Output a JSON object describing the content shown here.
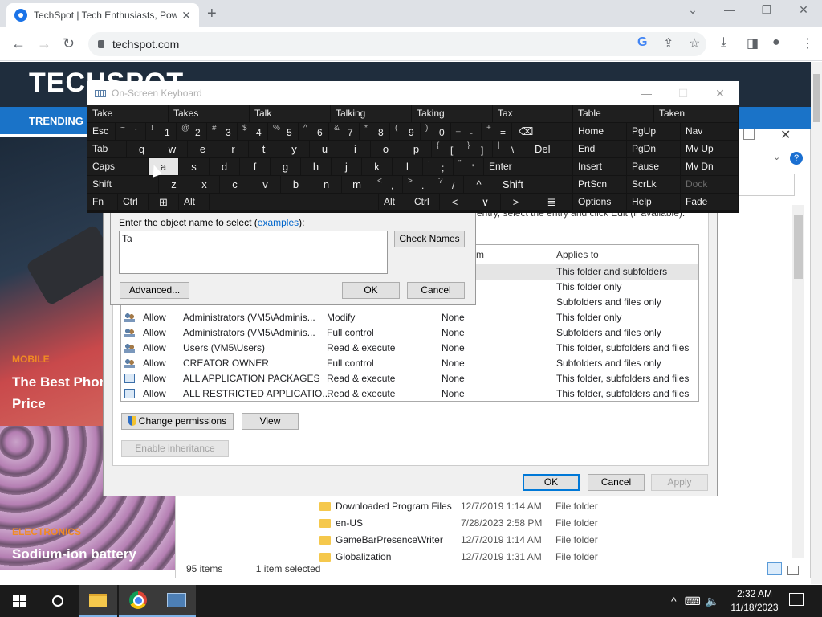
{
  "browser": {
    "tab_title": "TechSpot | Tech Enthusiasts, Pow",
    "tab_close": "✕",
    "new_tab": "+",
    "url": "techspot.com",
    "window_controls": [
      "⌄",
      "—",
      "❐",
      "✕"
    ]
  },
  "site": {
    "logo": "TECHSPOT",
    "trending": "TRENDING",
    "articles": [
      {
        "category": "MOBILE",
        "title": "The Best Phon for Every Price"
      },
      {
        "category": "ELECTRONICS",
        "title": "Sodium-ion battery breakthrough may be"
      }
    ]
  },
  "explorer": {
    "help": "?",
    "files": [
      {
        "name": "Downloaded Program Files",
        "date": "12/7/2019 1:14 AM",
        "type": "File folder"
      },
      {
        "name": "en-US",
        "date": "7/28/2023 2:58 PM",
        "type": "File folder"
      },
      {
        "name": "GameBarPresenceWriter",
        "date": "12/7/2019 1:14 AM",
        "type": "File folder"
      },
      {
        "name": "Globalization",
        "date": "12/7/2019 1:31 AM",
        "type": "File folder"
      }
    ],
    "status": {
      "count": "95 items",
      "selected": "1 item selected"
    }
  },
  "advanced_security": {
    "hint": "entry, select the entry and click Edit (if available).",
    "columns": {
      "from": "d from",
      "applies": "Applies to"
    },
    "hidden_rows_applies": [
      "This folder and subfolders",
      "This folder only",
      "Subfolders and files only"
    ],
    "rows": [
      {
        "type": "Allow",
        "principal": "Administrators (VM5\\Adminis...",
        "access": "Modify",
        "inherited": "None",
        "applies": "This folder only",
        "icon": "users"
      },
      {
        "type": "Allow",
        "principal": "Administrators (VM5\\Adminis...",
        "access": "Full control",
        "inherited": "None",
        "applies": "Subfolders and files only",
        "icon": "users"
      },
      {
        "type": "Allow",
        "principal": "Users (VM5\\Users)",
        "access": "Read & execute",
        "inherited": "None",
        "applies": "This folder, subfolders and files",
        "icon": "users"
      },
      {
        "type": "Allow",
        "principal": "CREATOR OWNER",
        "access": "Full control",
        "inherited": "None",
        "applies": "Subfolders and files only",
        "icon": "users"
      },
      {
        "type": "Allow",
        "principal": "ALL APPLICATION PACKAGES",
        "access": "Read & execute",
        "inherited": "None",
        "applies": "This folder, subfolders and files",
        "icon": "package"
      },
      {
        "type": "Allow",
        "principal": "ALL RESTRICTED APPLICATIO...",
        "access": "Read & execute",
        "inherited": "None",
        "applies": "This folder, subfolders and files",
        "icon": "package"
      }
    ],
    "buttons": {
      "change_permissions": "Change permissions",
      "view": "View",
      "enable_inheritance": "Enable inheritance",
      "ok": "OK",
      "cancel": "Cancel",
      "apply": "Apply"
    }
  },
  "select_dialog": {
    "label_prefix": "Enter the object name to select (",
    "label_link": "examples",
    "label_suffix": "):",
    "input_value": "Ta",
    "check_names": "Check Names",
    "advanced": "Advanced...",
    "ok": "OK",
    "cancel": "Cancel"
  },
  "osk": {
    "title": "On-Screen Keyboard",
    "controls": [
      "—",
      "☐",
      "✕"
    ],
    "predictions": [
      "Take",
      "Takes",
      "Talk",
      "Talking",
      "Taking",
      "Tax"
    ],
    "row1": {
      "esc": "Esc",
      "keys": [
        [
          "~",
          "`"
        ],
        [
          "!",
          "1"
        ],
        [
          "@",
          "2"
        ],
        [
          "#",
          "3"
        ],
        [
          "$",
          "4"
        ],
        [
          "%",
          "5"
        ],
        [
          "^",
          "6"
        ],
        [
          "&",
          "7"
        ],
        [
          "*",
          "8"
        ],
        [
          "(",
          "9"
        ],
        [
          ")",
          "0"
        ],
        [
          "_",
          "-"
        ],
        [
          "+",
          "="
        ]
      ],
      "backspace": "⌫"
    },
    "row2": {
      "tab": "Tab",
      "keys": [
        "q",
        "w",
        "e",
        "r",
        "t",
        "y",
        "u",
        "i",
        "o",
        "p"
      ],
      "brackets": [
        [
          "{",
          "["
        ],
        [
          "}",
          "]"
        ],
        [
          "|",
          "\\"
        ]
      ],
      "del": "Del"
    },
    "row3": {
      "caps": "Caps",
      "keys": [
        "a",
        "s",
        "d",
        "f",
        "g",
        "h",
        "j",
        "k",
        "l"
      ],
      "punct": [
        [
          ":",
          ";"
        ],
        [
          "\"",
          "'"
        ]
      ],
      "enter": "Enter"
    },
    "row4": {
      "shift": "Shift",
      "keys": [
        "z",
        "x",
        "c",
        "v",
        "b",
        "n",
        "m"
      ],
      "punct": [
        [
          "<",
          ","
        ],
        [
          ">",
          "."
        ],
        [
          "?",
          "/"
        ]
      ],
      "up": "^",
      "shift_r": "Shift"
    },
    "row5": {
      "fn": "Fn",
      "ctrl": "Ctrl",
      "win": "⊞",
      "alt": "Alt",
      "alt_r": "Alt",
      "ctrl_r": "Ctrl",
      "left": "<",
      "down": "∨",
      "right": ">",
      "menu": "≣"
    },
    "side": [
      [
        "Table",
        "Taken",
        ""
      ],
      [
        "Home",
        "PgUp",
        "Nav"
      ],
      [
        "End",
        "PgDn",
        "Mv Up"
      ],
      [
        "Insert",
        "Pause",
        "Mv Dn"
      ],
      [
        "PrtScn",
        "ScrLk",
        "Dock"
      ],
      [
        "Options",
        "Help",
        "Fade"
      ]
    ],
    "highlighted_key": "a"
  },
  "taskbar": {
    "time": "2:32 AM",
    "date": "11/18/2023",
    "tray": [
      "^",
      "⌨",
      "🔈"
    ]
  }
}
